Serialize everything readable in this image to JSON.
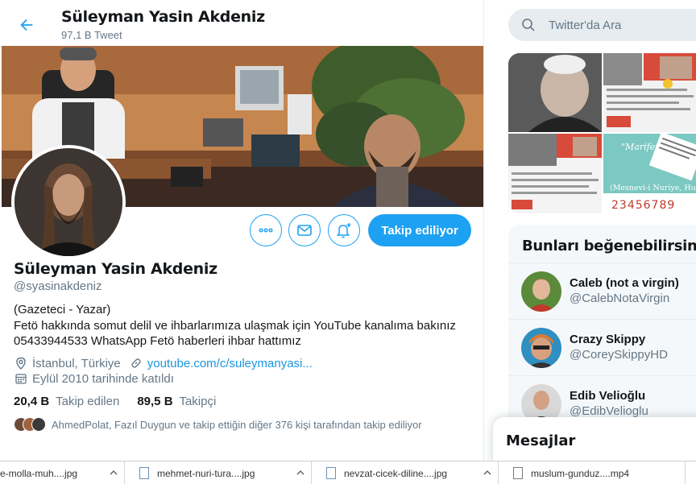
{
  "header": {
    "name": "Süleyman Yasin Akdeniz",
    "tweet_count": "97,1 B Tweet"
  },
  "profile": {
    "name": "Süleyman Yasin Akdeniz",
    "handle": "@syasinakdeniz",
    "follow_label": "Takip ediliyor",
    "bio_lines": [
      "(Gazeteci - Yazar)",
      "Fetö hakkında somut delil ve ihbarlarımıza ulaşmak için YouTube kanalıma bakınız",
      "05433944533 WhatsApp Fetö haberleri ihbar hattımız"
    ],
    "location": "İstanbul, Türkiye",
    "link": "youtube.com/c/suleymanyasi...",
    "joined": "Eylül 2010 tarihinde katıldı",
    "following_count": "20,4 B",
    "following_label": "Takip edilen",
    "followers_count": "89,5 B",
    "followers_label": "Takipçi",
    "followed_by": "AhmedPolat, Fazıl Duygun ve takip ettiğin diğer 376 kişi tarafından takip ediliyor"
  },
  "search": {
    "placeholder": "Twitter'da Ara"
  },
  "who_to_follow": {
    "title": "Bunları beğenebilirsin",
    "items": [
      {
        "name": "Caleb (not a virgin)",
        "handle": "@CalebNotaVirgin"
      },
      {
        "name": "Crazy Skippy",
        "handle": "@CoreySkippyHD"
      },
      {
        "name": "Edib Velioğlu",
        "handle": "@EdibVelioglu"
      }
    ]
  },
  "messages": {
    "title": "Mesajlar"
  },
  "media": {
    "quote_text": "\"Marifet...noora, d...olmadığı g...bile iştiyak geri ka...\"",
    "quote_source": "(Mesnevi-i Nuriye, Hubâb)",
    "digits": "23456789"
  },
  "downloads": [
    {
      "name": "e-molla-muh....jpg"
    },
    {
      "name": "mehmet-nuri-tura....jpg"
    },
    {
      "name": "nevzat-cicek-diline....jpg"
    },
    {
      "name": "muslum-gunduz....mp4"
    }
  ],
  "colors": {
    "accent": "#1da1f2",
    "link": "#1b95e0",
    "secondary_text": "#657786"
  }
}
